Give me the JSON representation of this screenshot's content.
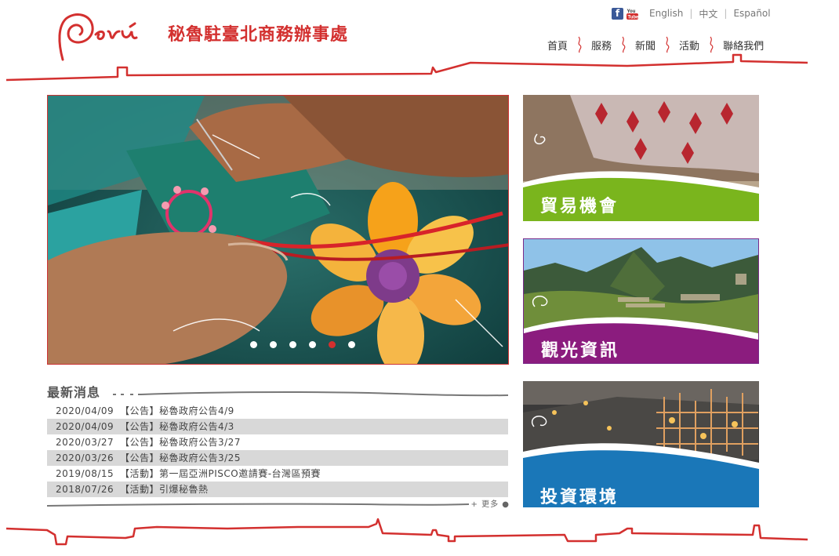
{
  "header": {
    "logo_text": "Perú",
    "site_title": "秘魯駐臺北商務辦事處",
    "social": [
      {
        "icon": "facebook-icon"
      },
      {
        "icon": "youtube-icon"
      }
    ],
    "languages": [
      "English",
      "中文",
      "Español"
    ],
    "nav": [
      "首頁",
      "服務",
      "新聞",
      "活動",
      "聯絡我們"
    ]
  },
  "hero": {
    "slide_count": 6,
    "active_index": 4
  },
  "news": {
    "title": "最新消息",
    "items": [
      {
        "date": "2020/04/09",
        "text": "【公告】秘魯政府公告4/9"
      },
      {
        "date": "2020/04/09",
        "text": "【公告】秘魯政府公告4/3"
      },
      {
        "date": "2020/03/27",
        "text": "【公告】秘魯政府公告3/27"
      },
      {
        "date": "2020/03/26",
        "text": "【公告】秘魯政府公告3/25"
      },
      {
        "date": "2019/08/15",
        "text": "【活動】第一屆亞洲PISCO邀請賽-台灣區預賽"
      },
      {
        "date": "2018/07/26",
        "text": "【活動】引爆秘魯熱"
      }
    ],
    "more_label": "+ 更多"
  },
  "tiles": [
    {
      "label": "貿易機會",
      "color": "#7ab51d"
    },
    {
      "label": "觀光資訊",
      "color": "#8b1c7e"
    },
    {
      "label": "投資環境",
      "color": "#1a77b8"
    }
  ],
  "colors": {
    "brand_red": "#d3302f",
    "stripe_gray": "#d8d8d8"
  }
}
